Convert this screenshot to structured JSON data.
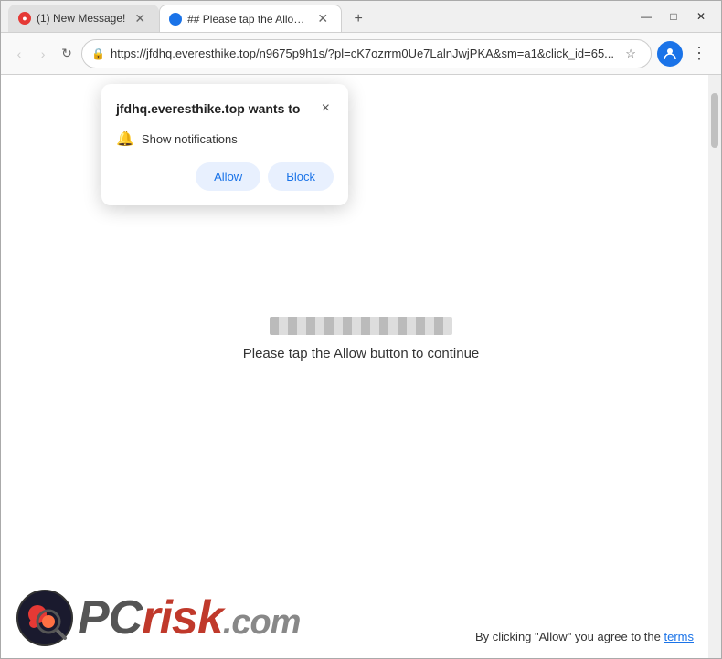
{
  "browser": {
    "tabs": [
      {
        "id": "tab1",
        "label": "(1) New Message!",
        "type": "msg",
        "active": false
      },
      {
        "id": "tab2",
        "label": "## Please tap the Allow button...",
        "type": "web",
        "active": true
      }
    ],
    "new_tab_label": "+",
    "window_controls": [
      "—",
      "□",
      "✕"
    ],
    "url": "https://jfdhq.everesthike.top/n9675p9h1s/?pl=cK7ozrrm0Ue7LalnJwjPKA&sm=a1&click_id=65...",
    "nav_back": "‹",
    "nav_forward": "›",
    "nav_refresh": "↻"
  },
  "popup": {
    "title": "jfdhq.everesthike.top wants to",
    "close_label": "×",
    "permission_text": "Show notifications",
    "allow_label": "Allow",
    "block_label": "Block"
  },
  "page": {
    "loading_text": "Please tap the Allow button to continue"
  },
  "footer": {
    "logo_text": "PC",
    "logo_risk": "risk",
    "logo_com": ".com",
    "disclaimer": "By clicking \"Allow\" you agree to the ",
    "terms_link": "terms"
  }
}
